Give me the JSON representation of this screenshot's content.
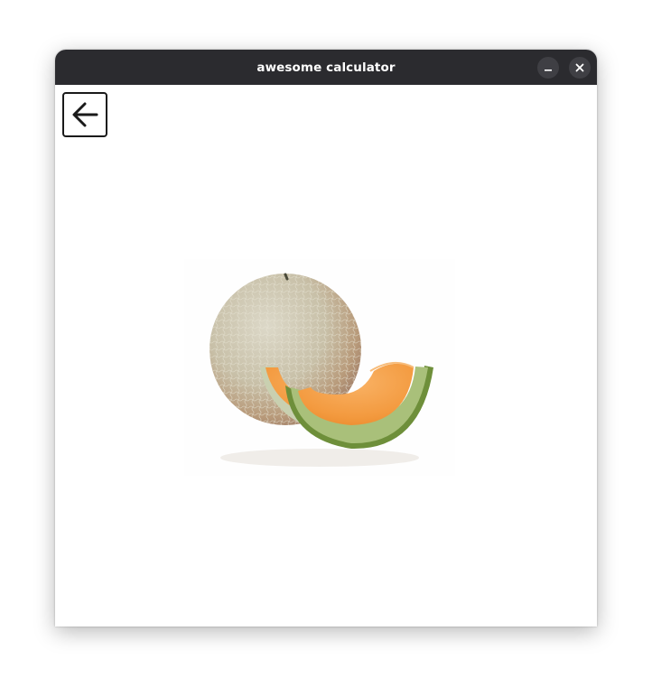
{
  "window": {
    "title": "awesome calculator",
    "controls": {
      "minimize_icon": "minimize-icon",
      "close_icon": "close-icon"
    }
  },
  "content": {
    "back_button_icon": "arrow-left-icon",
    "image": {
      "subject": "cantaloupe melon with a cut slice",
      "alt": "cantaloupe"
    }
  },
  "colors": {
    "titlebar_bg": "#2b2b2f",
    "titlebar_text": "#ffffff",
    "window_bg": "#ffffff",
    "melon_rind": "#c9c2ad",
    "melon_flesh": "#f39a3f",
    "melon_skin_green": "#6e8f3a"
  }
}
